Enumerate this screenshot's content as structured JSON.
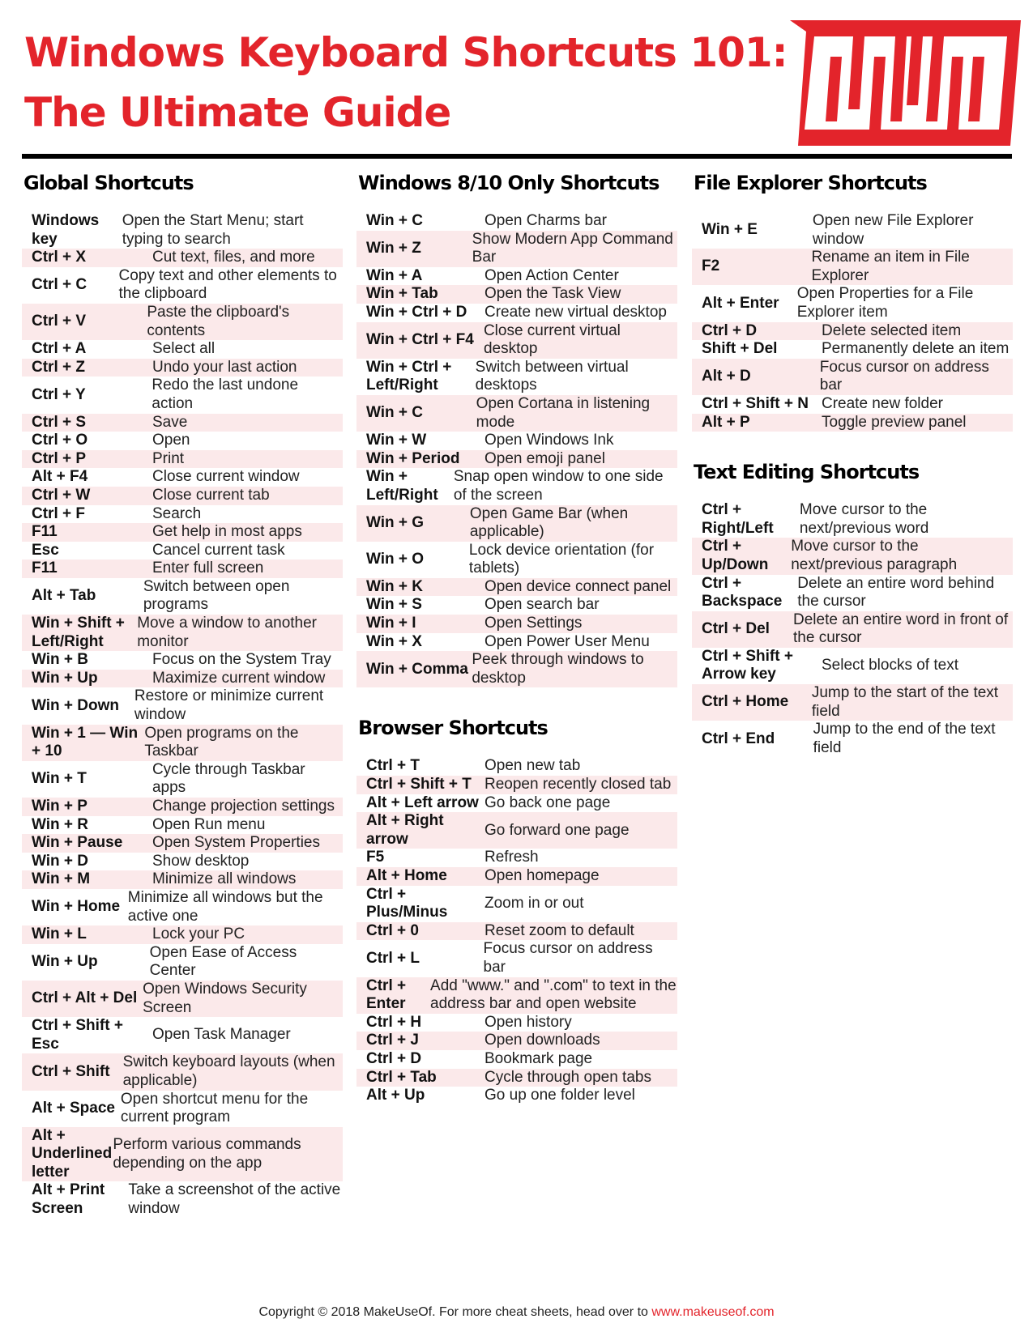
{
  "header": {
    "title_line1": "Windows Keyboard Shortcuts 101:",
    "title_line2": "The Ultimate Guide",
    "logo": "MUO",
    "accent_color": "#e3242b",
    "stripe_color": "#fbe9ea"
  },
  "sections": {
    "global": {
      "title": "Global Shortcuts",
      "rows": [
        {
          "key": "Windows key",
          "desc": "Open the Start Menu; start typing to search"
        },
        {
          "key": "Ctrl + X",
          "desc": "Cut text, files, and more"
        },
        {
          "key": "Ctrl + C",
          "desc": "Copy text and other elements to the clipboard"
        },
        {
          "key": "Ctrl + V",
          "desc": "Paste the clipboard's contents"
        },
        {
          "key": "Ctrl + A",
          "desc": "Select all"
        },
        {
          "key": "Ctrl + Z",
          "desc": "Undo your last action"
        },
        {
          "key": "Ctrl + Y",
          "desc": "Redo the last undone action"
        },
        {
          "key": "Ctrl + S",
          "desc": "Save"
        },
        {
          "key": "Ctrl + O",
          "desc": "Open"
        },
        {
          "key": "Ctrl + P",
          "desc": "Print"
        },
        {
          "key": "Alt + F4",
          "desc": "Close current window"
        },
        {
          "key": "Ctrl + W",
          "desc": "Close current tab"
        },
        {
          "key": "Ctrl + F",
          "desc": "Search"
        },
        {
          "key": "F11",
          "desc": "Get help in most apps"
        },
        {
          "key": "Esc",
          "desc": "Cancel current task"
        },
        {
          "key": "F11",
          "desc": "Enter full screen"
        },
        {
          "key": "Alt + Tab",
          "desc": "Switch between open programs"
        },
        {
          "key": "Win + Shift + Left/Right",
          "desc": "Move a window to another monitor"
        },
        {
          "key": "Win + B",
          "desc": "Focus on the System Tray"
        },
        {
          "key": "Win + Up",
          "desc": "Maximize current window"
        },
        {
          "key": "Win + Down",
          "desc": "Restore or minimize current window"
        },
        {
          "key": "Win + 1 — Win + 10",
          "desc": "Open programs on the Taskbar"
        },
        {
          "key": "Win + T",
          "desc": "Cycle through Taskbar apps"
        },
        {
          "key": "Win + P",
          "desc": "Change projection settings"
        },
        {
          "key": "Win + R",
          "desc": "Open Run menu"
        },
        {
          "key": "Win + Pause",
          "desc": "Open System Properties"
        },
        {
          "key": "Win + D",
          "desc": "Show desktop"
        },
        {
          "key": "Win + M",
          "desc": "Minimize all windows"
        },
        {
          "key": "Win + Home",
          "desc": "Minimize all windows but the active one"
        },
        {
          "key": "Win + L",
          "desc": "Lock your PC"
        },
        {
          "key": "Win + Up",
          "desc": "Open Ease of Access Center"
        },
        {
          "key": "Ctrl + Alt + Del",
          "desc": "Open Windows Security Screen"
        },
        {
          "key": "Ctrl + Shift + Esc",
          "desc": "Open Task Manager"
        },
        {
          "key": "Ctrl + Shift",
          "desc": "Switch keyboard layouts (when applicable)"
        },
        {
          "key": "Alt + Space",
          "desc": "Open shortcut menu for the current program"
        },
        {
          "key": "Alt + Underlined letter",
          "desc": "Perform various commands depending on the app"
        },
        {
          "key": "Alt + Print Screen",
          "desc": "Take a screenshot of the active window"
        }
      ]
    },
    "win810": {
      "title": "Windows 8/10 Only Shortcuts",
      "rows": [
        {
          "key": "Win + C",
          "desc": "Open Charms bar"
        },
        {
          "key": "Win + Z",
          "desc": "Show Modern App Command Bar"
        },
        {
          "key": "Win + A",
          "desc": "Open Action Center"
        },
        {
          "key": "Win + Tab",
          "desc": "Open the Task View"
        },
        {
          "key": "Win + Ctrl + D",
          "desc": "Create new virtual desktop"
        },
        {
          "key": "Win + Ctrl + F4",
          "desc": "Close current virtual desktop"
        },
        {
          "key": "Win + Ctrl + Left/Right",
          "desc": "Switch between virtual desktops"
        },
        {
          "key": "Win + C",
          "desc": "Open Cortana in listening mode"
        },
        {
          "key": "Win + W",
          "desc": "Open Windows Ink"
        },
        {
          "key": "Win + Period",
          "desc": "Open emoji panel"
        },
        {
          "key": "Win + Left/Right",
          "desc": "Snap open window to one side of the screen"
        },
        {
          "key": "Win + G",
          "desc": "Open Game Bar (when applicable)"
        },
        {
          "key": "Win + O",
          "desc": "Lock device orientation (for tablets)"
        },
        {
          "key": "Win + K",
          "desc": "Open device connect panel"
        },
        {
          "key": "Win + S",
          "desc": "Open search bar"
        },
        {
          "key": "Win + I",
          "desc": "Open Settings"
        },
        {
          "key": "Win + X",
          "desc": "Open Power User Menu"
        },
        {
          "key": "Win + Comma",
          "desc": "Peek through windows to desktop"
        }
      ]
    },
    "browser": {
      "title": "Browser Shortcuts",
      "rows": [
        {
          "key": "Ctrl + T",
          "desc": "Open new tab"
        },
        {
          "key": "Ctrl + Shift + T",
          "desc": "Reopen recently closed tab"
        },
        {
          "key": "Alt + Left arrow",
          "desc": "Go back one page"
        },
        {
          "key": "Alt + Right arrow",
          "desc": "Go forward one page"
        },
        {
          "key": "F5",
          "desc": "Refresh"
        },
        {
          "key": "Alt + Home",
          "desc": "Open homepage"
        },
        {
          "key": "Ctrl + Plus/Minus",
          "desc": "Zoom in or out"
        },
        {
          "key": "Ctrl + 0",
          "desc": "Reset zoom to default"
        },
        {
          "key": "Ctrl + L",
          "desc": "Focus cursor on address bar"
        },
        {
          "key": "Ctrl + Enter",
          "desc": "Add \"www.\" and \".com\" to text in the address bar and open website"
        },
        {
          "key": "Ctrl + H",
          "desc": "Open history"
        },
        {
          "key": "Ctrl + J",
          "desc": "Open downloads"
        },
        {
          "key": "Ctrl + D",
          "desc": "Bookmark page"
        },
        {
          "key": "Ctrl + Tab",
          "desc": "Cycle through open tabs"
        },
        {
          "key": "Alt + Up",
          "desc": "Go up one folder level"
        }
      ]
    },
    "explorer": {
      "title": "File Explorer Shortcuts",
      "rows": [
        {
          "key": "Win + E",
          "desc": "Open new File Explorer window"
        },
        {
          "key": "F2",
          "desc": "Rename an item in File Explorer"
        },
        {
          "key": "Alt + Enter",
          "desc": "Open Properties for a File Explorer item"
        },
        {
          "key": "Ctrl + D",
          "desc": "Delete selected item"
        },
        {
          "key": "Shift + Del",
          "desc": "Permanently delete an item"
        },
        {
          "key": "Alt + D",
          "desc": "Focus cursor on address bar"
        },
        {
          "key": "Ctrl + Shift + N",
          "desc": "Create new folder"
        },
        {
          "key": "Alt + P",
          "desc": "Toggle preview panel"
        }
      ]
    },
    "text": {
      "title": "Text Editing Shortcuts",
      "rows": [
        {
          "key": "Ctrl + Right/Left",
          "desc": "Move cursor to the next/previous word"
        },
        {
          "key": "Ctrl + Up/Down",
          "desc": "Move cursor to the next/previous paragraph"
        },
        {
          "key": "Ctrl + Backspace",
          "desc": "Delete an entire word behind the cursor"
        },
        {
          "key": "Ctrl + Del",
          "desc": "Delete an entire word in front of the cursor"
        },
        {
          "key": "Ctrl + Shift + Arrow key",
          "desc": "Select blocks of text"
        },
        {
          "key": "Ctrl + Home",
          "desc": "Jump to the start of the text field"
        },
        {
          "key": "Ctrl + End",
          "desc": "Jump to the end of the text field"
        }
      ]
    }
  },
  "footer": {
    "text": "Copyright © 2018 MakeUseOf. For more cheat sheets, head over to ",
    "link": "www.makeuseof.com"
  }
}
